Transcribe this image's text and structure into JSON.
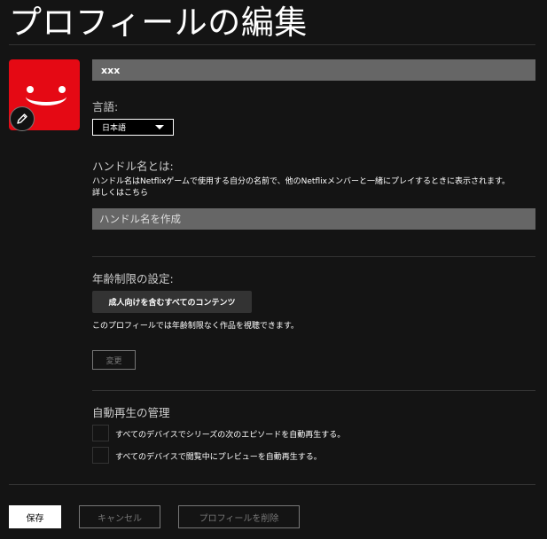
{
  "header": {
    "title": "プロフィールの編集"
  },
  "profile": {
    "avatar_icon": "smiley-face",
    "edit_icon": "pencil-icon",
    "name_value": "xxx",
    "accent_color": "#e50914"
  },
  "language": {
    "label": "言語:",
    "selected": "日本語"
  },
  "handle": {
    "heading": "ハンドル名とは:",
    "description": "ハンドル名はNetflixゲームで使用する自分の名前で、他のNetflixメンバーと一緒にプレイするときに表示されます。 詳しくはこちら",
    "placeholder": "ハンドル名を作成"
  },
  "maturity": {
    "heading": "年齢制限の設定:",
    "badge": "成人向けを含むすべてのコンテンツ",
    "description": "このプロフィールでは年齢制限なく作品を視聴できます。",
    "change_label": "変更"
  },
  "autoplay": {
    "heading": "自動再生の管理",
    "options": [
      {
        "label": "すべてのデバイスでシリーズの次のエピソードを自動再生する。",
        "checked": false
      },
      {
        "label": "すべてのデバイスで閲覧中にプレビューを自動再生する。",
        "checked": false
      }
    ]
  },
  "actions": {
    "save": "保存",
    "cancel": "キャンセル",
    "delete": "プロフィールを削除"
  }
}
